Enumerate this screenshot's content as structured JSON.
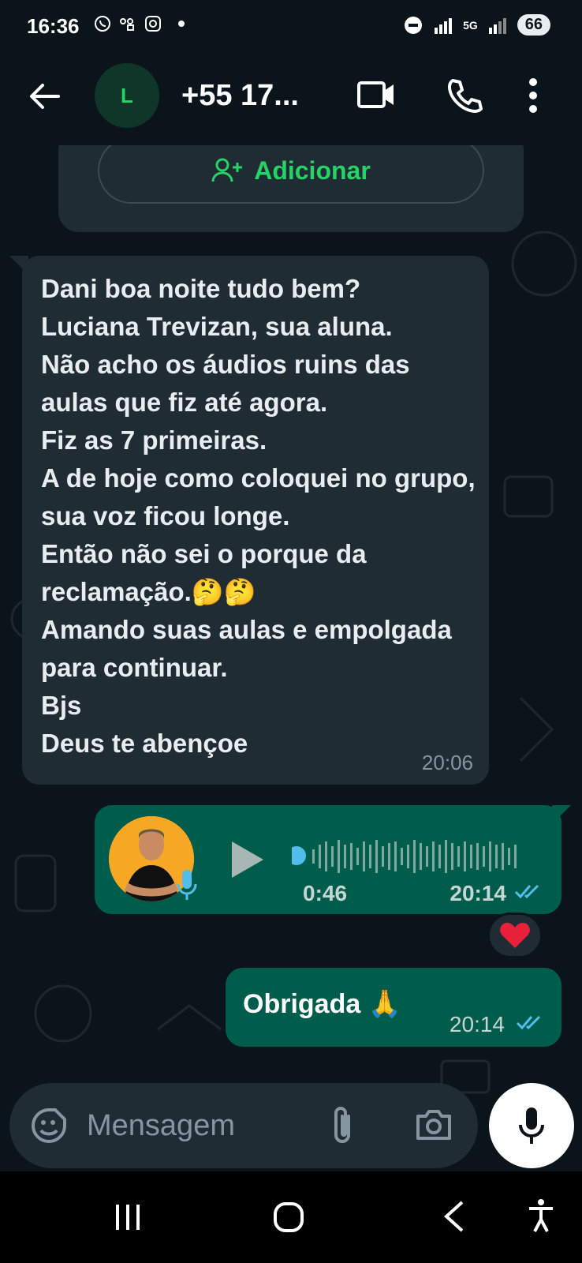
{
  "status_bar": {
    "time": "16:36",
    "battery": "66",
    "network": "5G"
  },
  "header": {
    "avatar_letter": "L",
    "contact_name": "+55 17..."
  },
  "add_contact": {
    "label": "Adicionar"
  },
  "messages": [
    {
      "direction": "incoming",
      "text": "Dani boa noite tudo bem?\nLuciana Trevizan, sua aluna.\nNão acho os áudios ruins das aulas que fiz até agora.\nFiz as 7 primeiras.\nA de hoje como coloquei no grupo, sua voz ficou longe.\nEntão não sei o porque da reclamação.🤔🤔\nAmando suas aulas e empolgada para continuar.\nBjs\nDeus te abençoe",
      "time": "20:06"
    },
    {
      "direction": "outgoing",
      "type": "voice",
      "duration": "0:46",
      "time": "20:14",
      "status": "read",
      "reaction": "❤️"
    },
    {
      "direction": "outgoing",
      "text": "Obrigada 🙏",
      "time": "20:14",
      "status": "read"
    }
  ],
  "composer": {
    "placeholder": "Mensagem"
  },
  "colors": {
    "background": "#0b141a",
    "incoming_bubble": "#1f2c34",
    "outgoing_bubble": "#005c4b",
    "accent": "#25d366",
    "read_ticks": "#53bdeb"
  },
  "icons": [
    "back-arrow-icon",
    "video-call-icon",
    "phone-icon",
    "more-vert-icon",
    "add-person-icon",
    "play-icon",
    "mic-icon",
    "double-check-icon",
    "emoji-icon",
    "attach-icon",
    "camera-icon"
  ]
}
